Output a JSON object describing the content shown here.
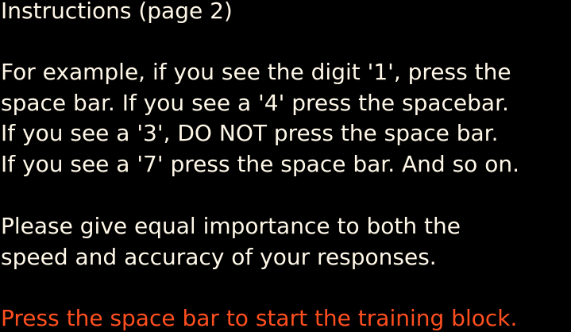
{
  "screen": {
    "title": "Instructions (page 2)",
    "example_lines": [
      "For example, if you see the digit '1', press the",
      "space bar. If you see a '4' press the spacebar.",
      "If you see a '3', DO NOT press the space bar.",
      "If you see a '7' press the space bar. And so on."
    ],
    "guidance_lines": [
      "Please give equal importance to both the",
      "speed and accuracy of your responses."
    ],
    "prompt": "Press the space bar to start the training block."
  },
  "colors": {
    "background": "#000000",
    "text": "#fff8e8",
    "prompt": "#ff4f1f"
  }
}
